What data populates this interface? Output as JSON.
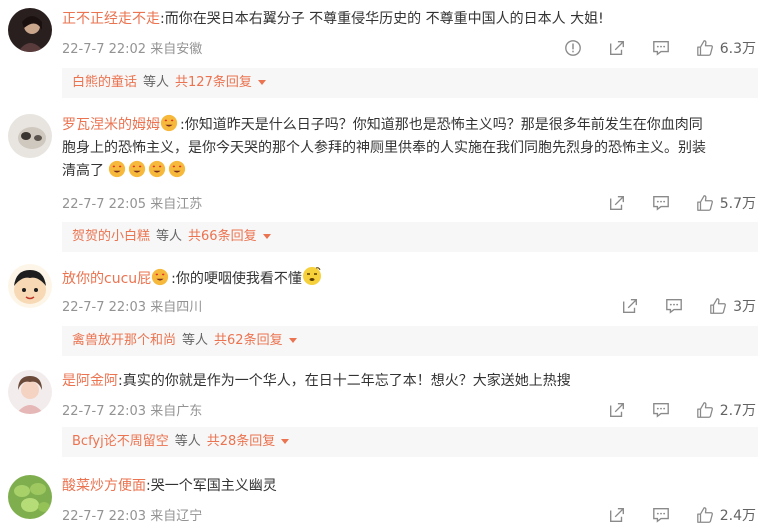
{
  "comments": [
    {
      "username": "正不正经走不走",
      "text": ":而你在哭日本右翼分子 不尊重侵华历史的 不尊重中国人的日本人 大姐!",
      "time": "22-7-7 22:02",
      "location": "来自安徽",
      "likes": "6.3万",
      "has_report": true,
      "replies": {
        "user": "白熊的童话",
        "mid": "等人",
        "count": "共127条回复"
      }
    },
    {
      "username": "罗瓦涅米的姆姆",
      "text_lines": [
        ":你知道昨天是什么日子吗？你知道那也是恐怖主义吗？那是很多年前发生在你血肉同",
        "胞身上的恐怖主义，是你今天哭的那个人参拜的神厕里供奉的人实施在我们同胞先烈身的恐怖主义。别装",
        "清高了"
      ],
      "time": "22-7-7 22:05",
      "location": "来自江苏",
      "likes": "5.7万",
      "replies": {
        "user": "贺贺的小白糕",
        "mid": "等人",
        "count": "共66条回复"
      }
    },
    {
      "username": "放你的cucu屁",
      "text": ":你的哽咽使我看不懂",
      "time": "22-7-7 22:03",
      "location": "来自四川",
      "likes": "3万",
      "replies": {
        "user": "禽兽放开那个和尚",
        "mid": "等人",
        "count": "共62条回复"
      }
    },
    {
      "username": "是阿金阿",
      "text": ":真实的你就是作为一个华人，在日十二年忘了本！想火？大家送她上热搜",
      "time": "22-7-7 22:03",
      "location": "来自广东",
      "likes": "2.7万",
      "replies": {
        "user": "Bcfyj论不周留空",
        "mid": "等人",
        "count": "共28条回复"
      }
    },
    {
      "username": "酸菜炒方便面",
      "text": ":哭一个军国主义幽灵",
      "time": "22-7-7 22:03",
      "location": "来自辽宁",
      "likes": "2.4万"
    }
  ],
  "icons": {
    "report": "report-icon",
    "share": "share-icon",
    "comment": "comment-icon",
    "like": "like-icon"
  },
  "colors": {
    "username": "#eb7350",
    "meta": "#939393",
    "reply_bg": "#f7f7f7"
  }
}
